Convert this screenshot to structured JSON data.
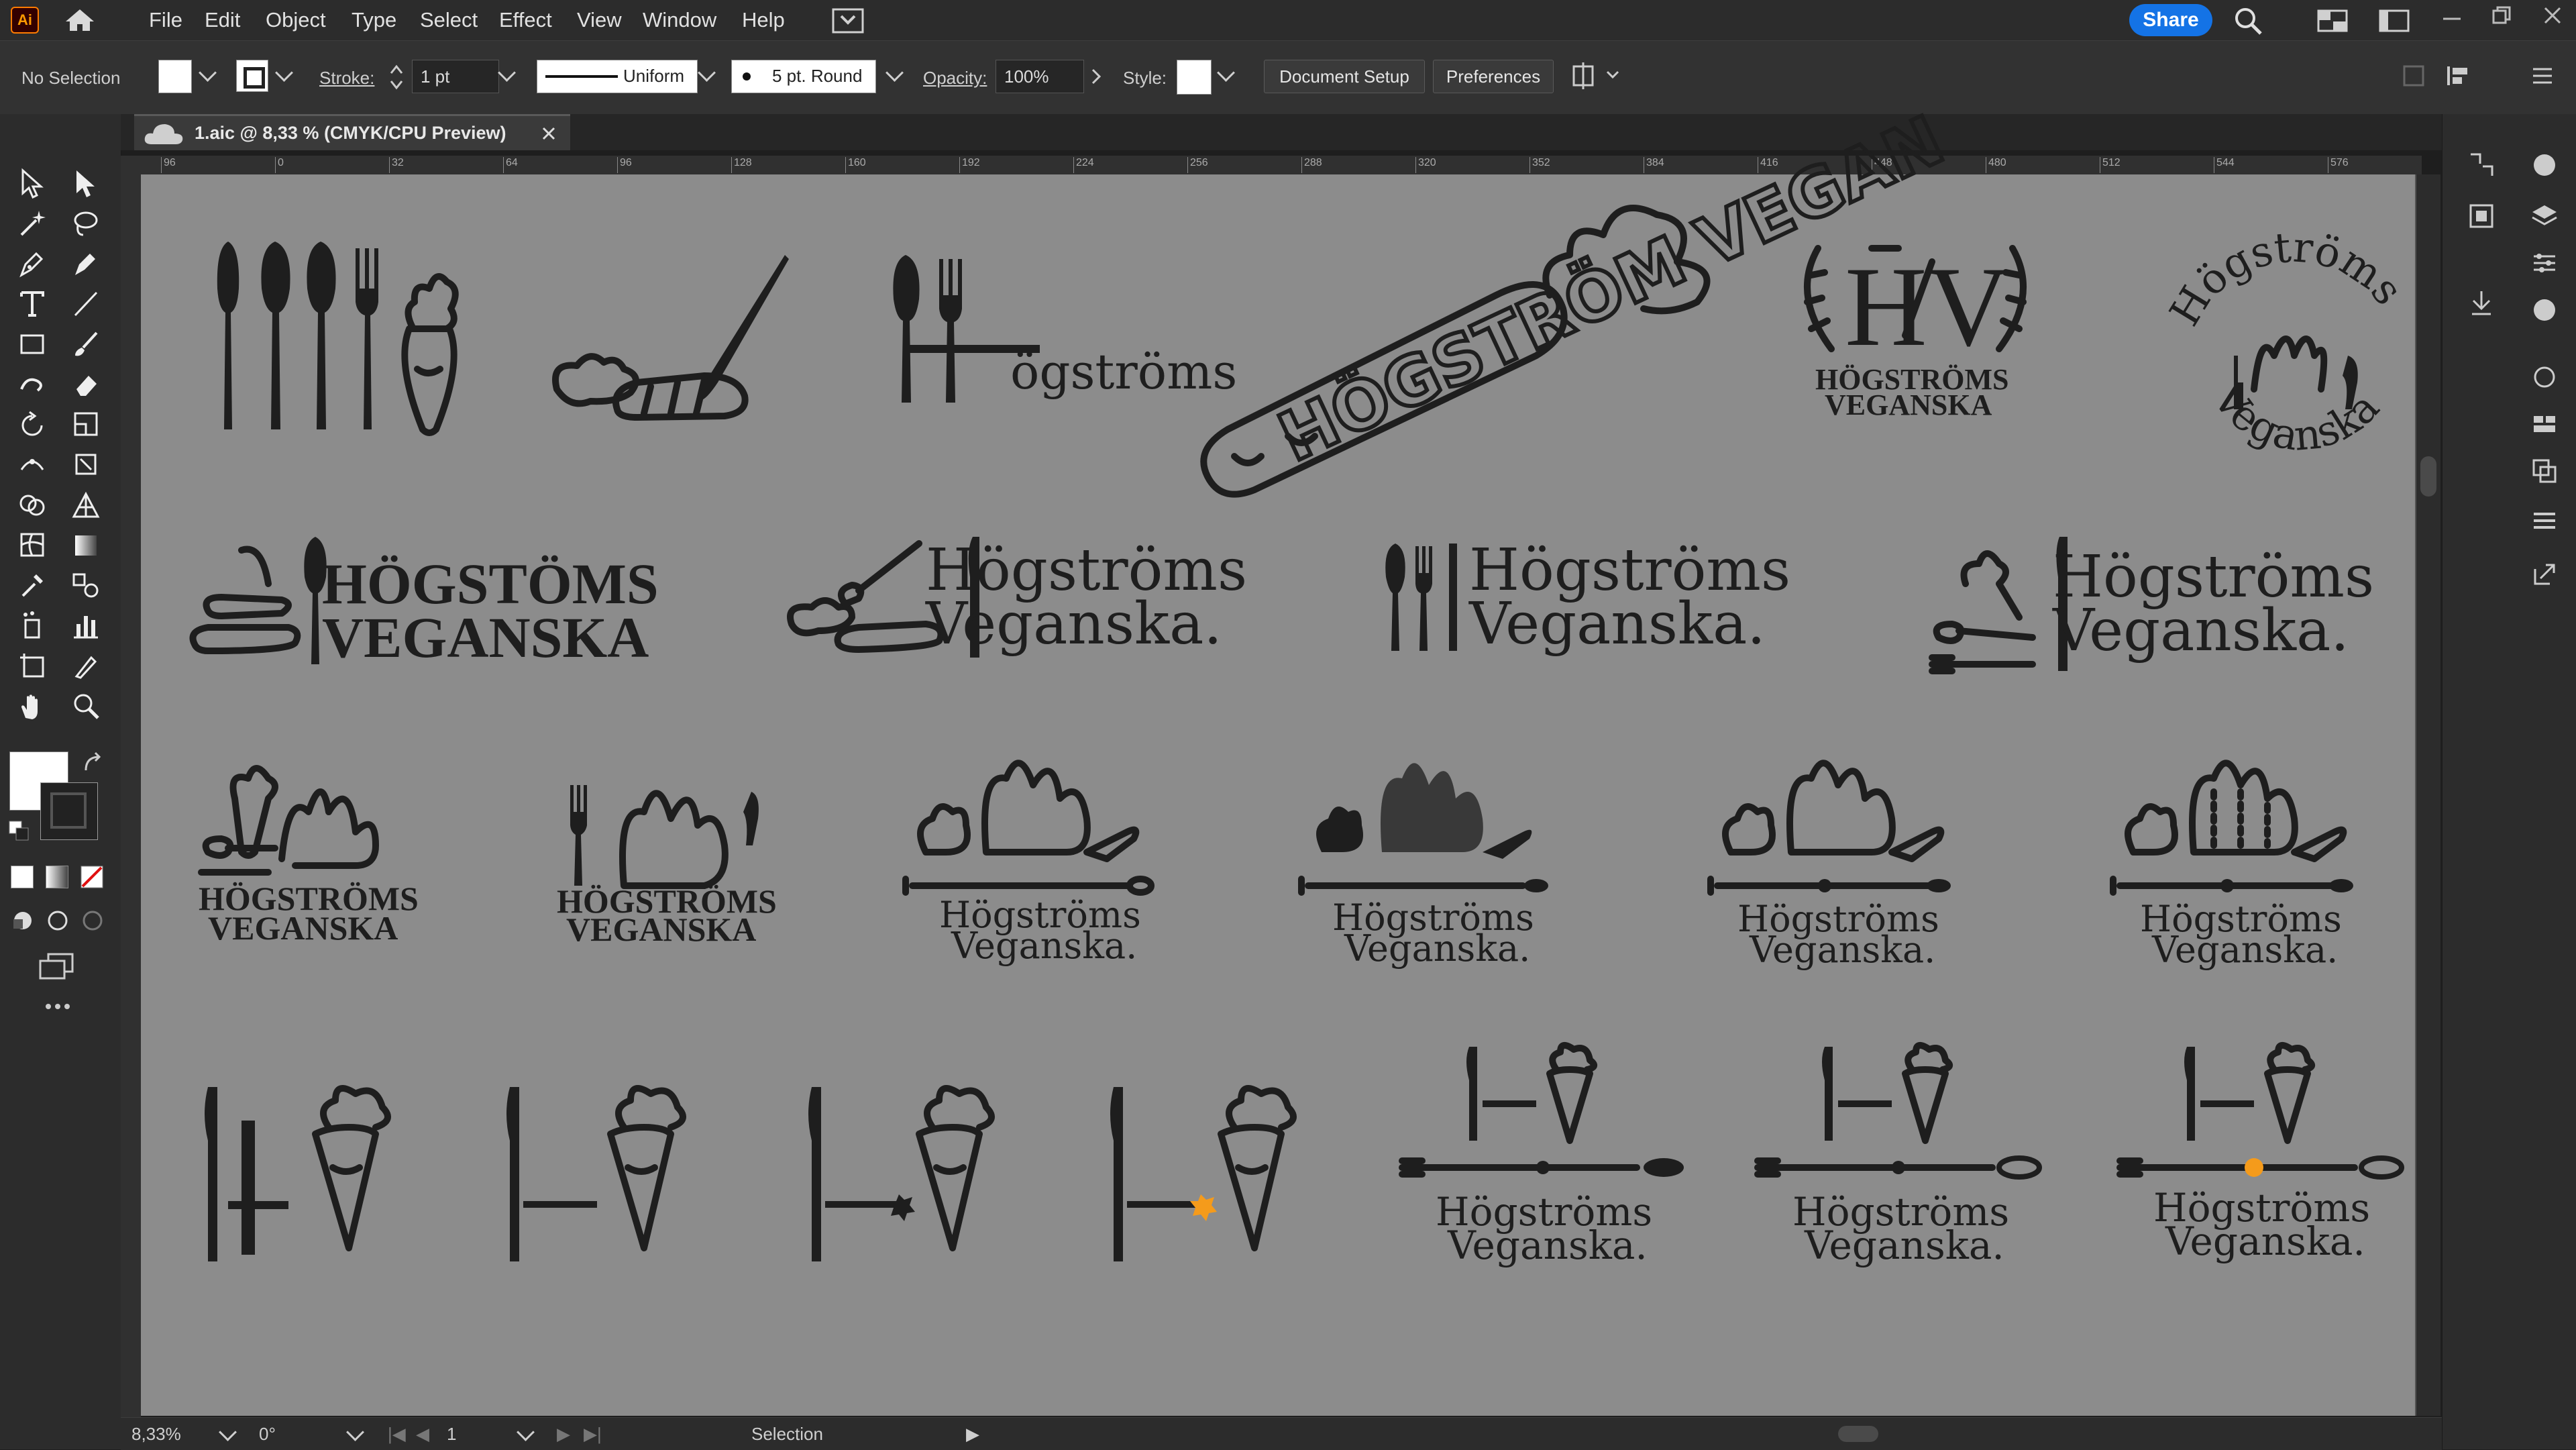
{
  "app": {
    "logo": "Ai"
  },
  "menu": [
    "File",
    "Edit",
    "Object",
    "Type",
    "Select",
    "Effect",
    "View",
    "Window",
    "Help"
  ],
  "share_label": "Share",
  "control": {
    "selection": "No Selection",
    "stroke_label": "Stroke:",
    "stroke_value": "1 pt",
    "profile": "Uniform",
    "brush": "5 pt. Round",
    "opacity_label": "Opacity:",
    "opacity_value": "100%",
    "style_label": "Style:",
    "doc_setup": "Document Setup",
    "preferences": "Preferences"
  },
  "document": {
    "tab_title": "1.aic @ 8,33 % (CMYK/CPU Preview)"
  },
  "ruler": [
    "96",
    "0",
    "32",
    "64",
    "96",
    "128",
    "160",
    "192",
    "224",
    "256",
    "288",
    "320",
    "352",
    "384",
    "416",
    "448",
    "480",
    "512",
    "544",
    "576"
  ],
  "status": {
    "zoom": "8,33%",
    "rotation": "0°",
    "artboard": "1",
    "mode": "Selection"
  },
  "logos": {
    "row1_wordmark": "ögströms",
    "row1_arc_text": "HÖGSTRÖM VEGAN",
    "hv": "HV",
    "hv_sub1": "HÖGSTRÖMS",
    "hv_sub2": "VEGANSKA",
    "circle_top": "Högströms",
    "circle_bottom": "Veganska",
    "row2_a1": "HÖGSTÖMS",
    "row2_a2": "VEGANSKA",
    "brand1": "Högströms",
    "brand2": "Veganska."
  },
  "colors": {
    "accent": "#f59b1b",
    "share": "#1473e6",
    "ink": "#1e1e1e"
  }
}
